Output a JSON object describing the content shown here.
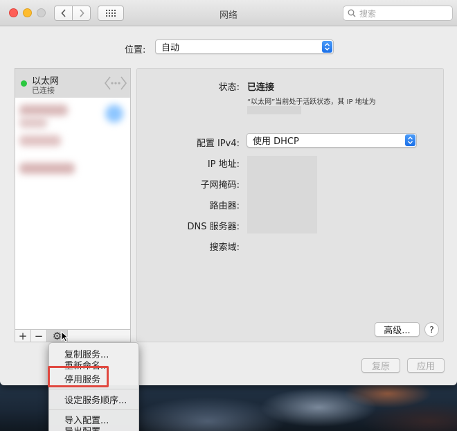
{
  "window": {
    "title": "网络"
  },
  "search": {
    "placeholder": "搜索"
  },
  "location": {
    "label": "位置:",
    "value": "自动"
  },
  "sidebar": {
    "services": [
      {
        "name": "以太网",
        "status": "已连接",
        "status_color": "#2bc840"
      }
    ],
    "footer": {
      "add": "+",
      "remove": "−",
      "gear": "⚙"
    }
  },
  "detail": {
    "status_label": "状态:",
    "status_value": "已连接",
    "status_desc": "“以太网”当前处于活跃状态，其 IP 地址为",
    "config_label": "配置 IPv4:",
    "config_value": "使用 DHCP",
    "ip_label": "IP 地址:",
    "mask_label": "子网掩码:",
    "router_label": "路由器:",
    "dns_label": "DNS 服务器:",
    "search_domain_label": "搜索域:",
    "advanced_label": "高级...",
    "help_label": "?"
  },
  "actions": {
    "revert": "复原",
    "apply": "应用"
  },
  "gear_menu": {
    "items": [
      "复制服务...",
      "重新命名...",
      "停用服务",
      "设定服务顺序...",
      "导入配置...",
      "导出配置..."
    ],
    "highlight_color": "#e0483f"
  }
}
